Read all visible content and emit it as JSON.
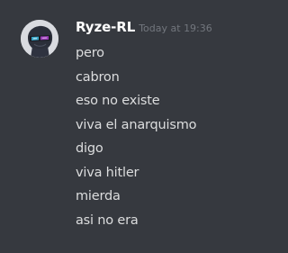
{
  "message": {
    "author": "Ryze-RL",
    "timestamp": "Today at 19:36",
    "lines": [
      "pero",
      "cabron",
      "eso no existe",
      "viva el anarquismo",
      "digo",
      "viva hitler",
      "mierda",
      "asi no era"
    ]
  },
  "colors": {
    "background": "#36393f",
    "username": "#ffffff",
    "timestamp": "#72767d",
    "text": "#dcddde"
  }
}
